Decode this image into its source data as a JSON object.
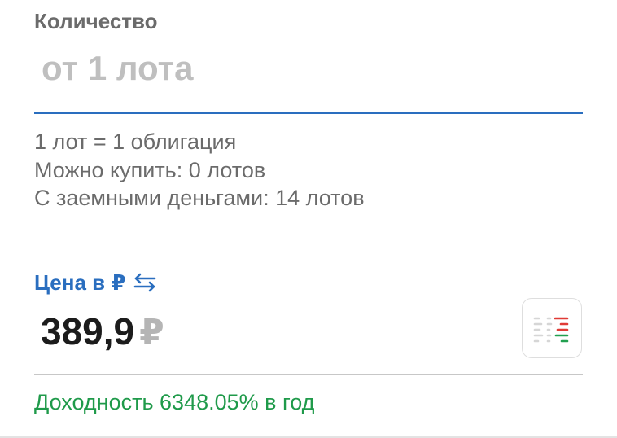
{
  "quantity": {
    "label": "Количество",
    "value": "",
    "placeholder": "от 1 лота"
  },
  "info": {
    "lot_size": "1 лот = 1 облигация",
    "can_buy": "Можно купить: 0 лотов",
    "with_margin": "С заемными деньгами: 14 лотов"
  },
  "price": {
    "label": "Цена в ₽",
    "swap_icon": "swap-arrows-icon",
    "value": "389,9",
    "currency": "₽",
    "orderbook_icon": "order-book-icon"
  },
  "yield": {
    "text": "Доходность 6348.05% в год"
  },
  "colors": {
    "accent_blue": "#2a6ebf",
    "yield_green": "#1f9a4a",
    "muted_text": "#6b6b6b",
    "placeholder_gray": "#bfbfbf",
    "orderbook_red": "#e03b36",
    "orderbook_green": "#22a050"
  }
}
